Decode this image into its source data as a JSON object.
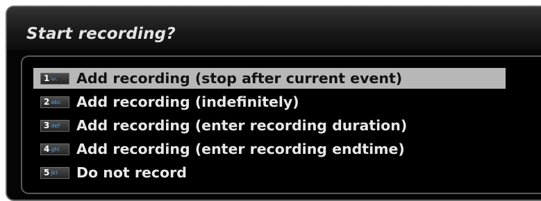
{
  "dialog": {
    "title": "Start recording?",
    "items": [
      {
        "key": "1",
        "sub": "ω.",
        "label": "Add recording (stop after current event)",
        "selected": true
      },
      {
        "key": "2",
        "sub": "abc",
        "label": "Add recording (indefinitely)",
        "selected": false
      },
      {
        "key": "3",
        "sub": "def",
        "label": "Add recording (enter recording duration)",
        "selected": false
      },
      {
        "key": "4",
        "sub": "ghi",
        "label": "Add recording (enter recording endtime)",
        "selected": false
      },
      {
        "key": "5",
        "sub": "jkl",
        "label": "Do not record",
        "selected": false
      }
    ]
  },
  "colors": {
    "background": "#050505",
    "selected_row": "#b7b7b7",
    "text": "#e8e8e8",
    "key_subtext": "#5f9edc"
  }
}
